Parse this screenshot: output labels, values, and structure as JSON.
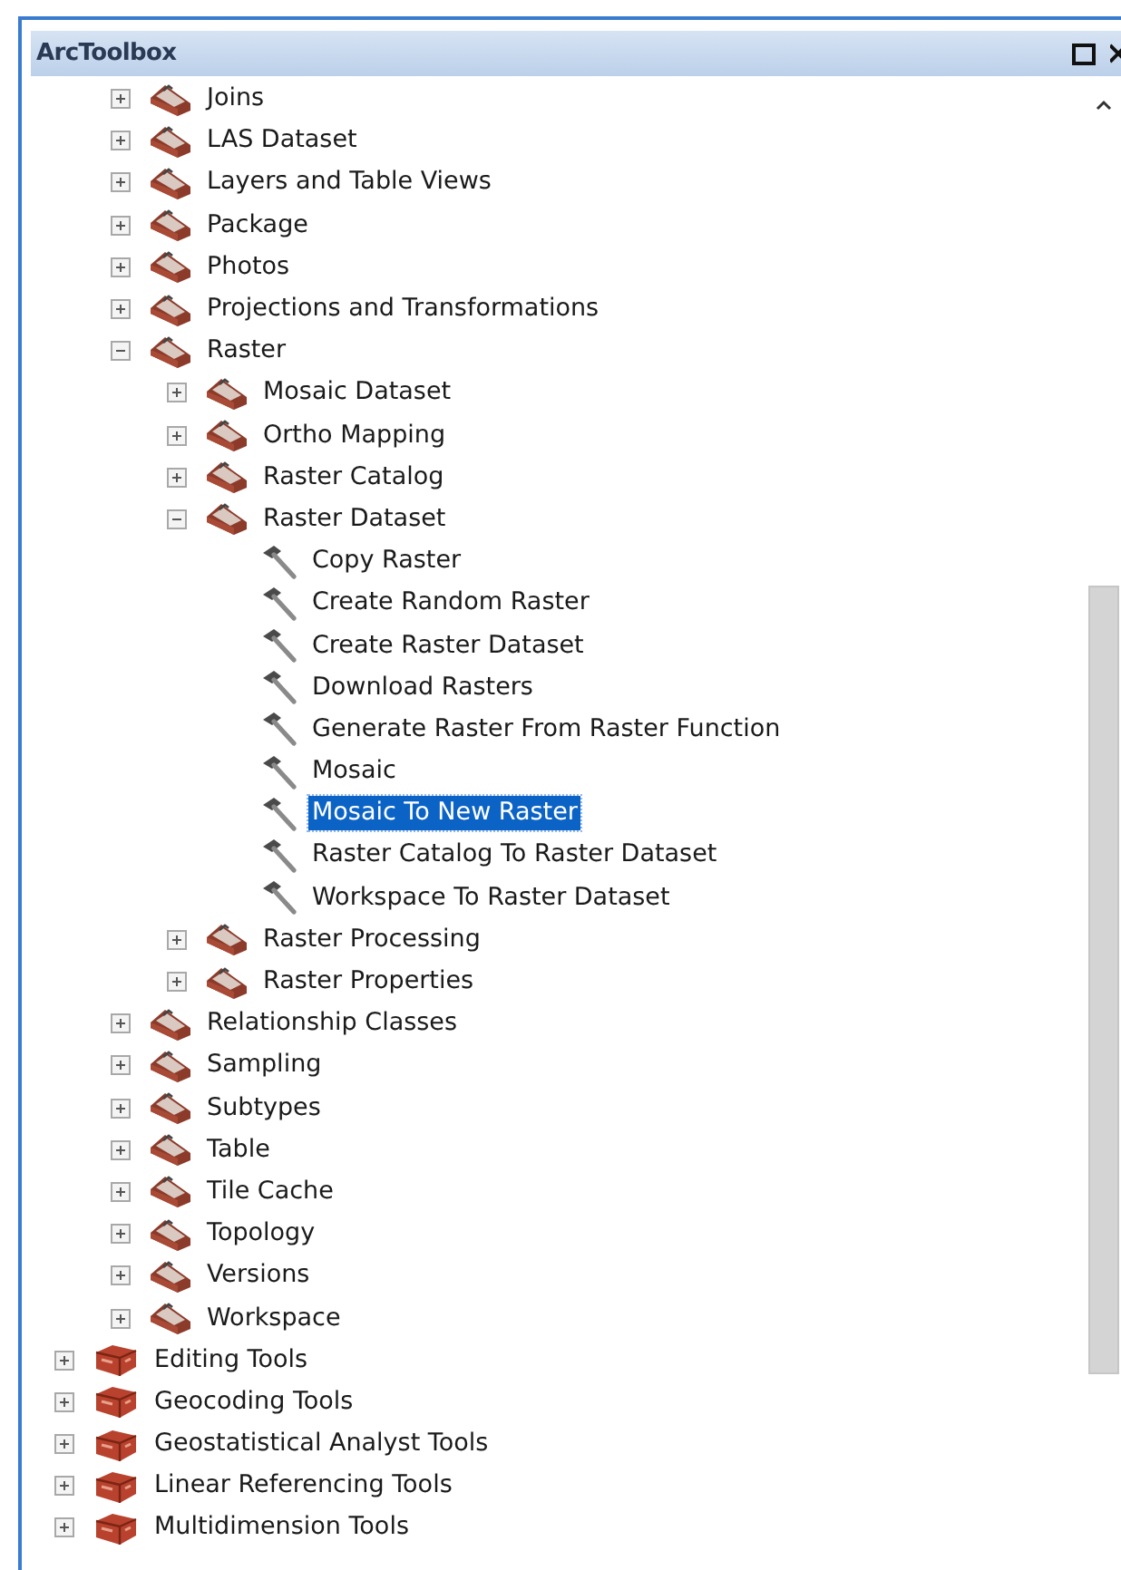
{
  "window": {
    "title": "ArcToolbox"
  },
  "toolbox_tree": {
    "continued_children": [
      {
        "kind": "toolset",
        "label": "Joins",
        "expanded": false,
        "selected": false
      },
      {
        "kind": "toolset",
        "label": "LAS Dataset",
        "expanded": false,
        "selected": false
      },
      {
        "kind": "toolset",
        "label": "Layers and Table Views",
        "expanded": false,
        "selected": false
      },
      {
        "kind": "toolset",
        "label": "Package",
        "expanded": false,
        "selected": false
      },
      {
        "kind": "toolset",
        "label": "Photos",
        "expanded": false,
        "selected": false
      },
      {
        "kind": "toolset",
        "label": "Projections and Transformations",
        "expanded": false,
        "selected": false
      },
      {
        "kind": "toolset",
        "label": "Raster",
        "expanded": true,
        "selected": false,
        "children": [
          {
            "kind": "toolset",
            "label": "Mosaic Dataset",
            "expanded": false,
            "selected": false
          },
          {
            "kind": "toolset",
            "label": "Ortho Mapping",
            "expanded": false,
            "selected": false
          },
          {
            "kind": "toolset",
            "label": "Raster Catalog",
            "expanded": false,
            "selected": false
          },
          {
            "kind": "toolset",
            "label": "Raster Dataset",
            "expanded": true,
            "selected": false,
            "children": [
              {
                "kind": "tool",
                "label": "Copy Raster",
                "selected": false
              },
              {
                "kind": "tool",
                "label": "Create Random Raster",
                "selected": false
              },
              {
                "kind": "tool",
                "label": "Create Raster Dataset",
                "selected": false
              },
              {
                "kind": "tool",
                "label": "Download Rasters",
                "selected": false
              },
              {
                "kind": "tool",
                "label": "Generate Raster From Raster Function",
                "selected": false
              },
              {
                "kind": "tool",
                "label": "Mosaic",
                "selected": false
              },
              {
                "kind": "tool",
                "label": "Mosaic To New Raster",
                "selected": true
              },
              {
                "kind": "tool",
                "label": "Raster Catalog To Raster Dataset",
                "selected": false
              },
              {
                "kind": "tool",
                "label": "Workspace To Raster Dataset",
                "selected": false
              }
            ]
          },
          {
            "kind": "toolset",
            "label": "Raster Processing",
            "expanded": false,
            "selected": false
          },
          {
            "kind": "toolset",
            "label": "Raster Properties",
            "expanded": false,
            "selected": false
          }
        ]
      },
      {
        "kind": "toolset",
        "label": "Relationship Classes",
        "expanded": false,
        "selected": false
      },
      {
        "kind": "toolset",
        "label": "Sampling",
        "expanded": false,
        "selected": false
      },
      {
        "kind": "toolset",
        "label": "Subtypes",
        "expanded": false,
        "selected": false
      },
      {
        "kind": "toolset",
        "label": "Table",
        "expanded": false,
        "selected": false
      },
      {
        "kind": "toolset",
        "label": "Tile Cache",
        "expanded": false,
        "selected": false
      },
      {
        "kind": "toolset",
        "label": "Topology",
        "expanded": false,
        "selected": false
      },
      {
        "kind": "toolset",
        "label": "Versions",
        "expanded": false,
        "selected": false
      },
      {
        "kind": "toolset",
        "label": "Workspace",
        "expanded": false,
        "selected": false
      }
    ],
    "toolboxes": [
      {
        "kind": "toolbox",
        "label": "Editing Tools",
        "expanded": false,
        "selected": false
      },
      {
        "kind": "toolbox",
        "label": "Geocoding Tools",
        "expanded": false,
        "selected": false
      },
      {
        "kind": "toolbox",
        "label": "Geostatistical Analyst Tools",
        "expanded": false,
        "selected": false
      },
      {
        "kind": "toolbox",
        "label": "Linear Referencing Tools",
        "expanded": false,
        "selected": false
      },
      {
        "kind": "toolbox",
        "label": "Multidimension Tools",
        "expanded": false,
        "selected": false
      }
    ]
  }
}
